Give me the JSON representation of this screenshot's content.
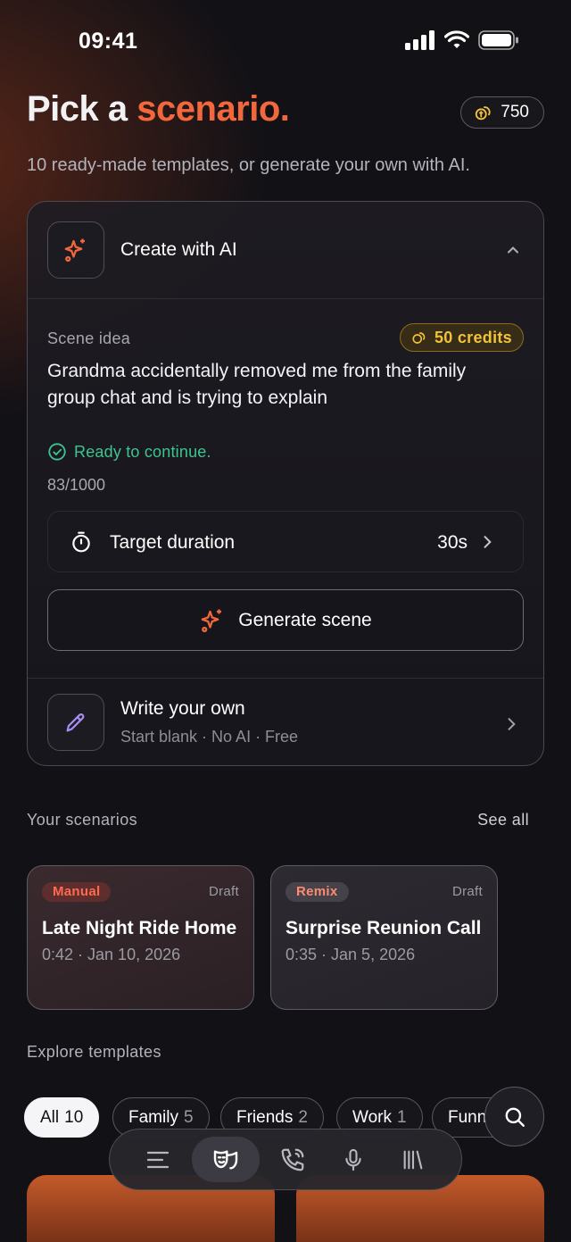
{
  "status": {
    "time": "09:41"
  },
  "header": {
    "title_main": "Pick a ",
    "title_accent": "scenario.",
    "credits": "750",
    "subtitle": "10 ready-made templates, or generate your own with AI."
  },
  "create_ai": {
    "title": "Create with AI",
    "scene_label": "Scene idea",
    "cost": "50 credits",
    "scene_text": "Grandma accidentally removed me from the family group chat and is trying to explain",
    "status": "Ready to continue.",
    "counter": "83/1000",
    "duration_label": "Target duration",
    "duration_value": "30s",
    "generate_label": "Generate scene"
  },
  "write_own": {
    "title": "Write your own",
    "subtitle": "Start blank · No AI · Free"
  },
  "your_scenarios": {
    "label": "Your scenarios",
    "see_all": "See all",
    "items": [
      {
        "badge": "Manual",
        "status": "Draft",
        "title": "Late Night Ride Home",
        "meta": "0:42 · Jan 10, 2026"
      },
      {
        "badge": "Remix",
        "status": "Draft",
        "title": "Surprise Reunion Call",
        "meta": "0:35 · Jan 5, 2026"
      }
    ]
  },
  "explore": {
    "label": "Explore templates",
    "chips": [
      {
        "label": "All",
        "count": "10"
      },
      {
        "label": "Family",
        "count": "5"
      },
      {
        "label": "Friends",
        "count": "2"
      },
      {
        "label": "Work",
        "count": "1"
      },
      {
        "label": "Funny",
        "count": ""
      }
    ]
  },
  "nav": {
    "items": [
      "menu-icon",
      "theater-masks-icon",
      "phone-icon",
      "microphone-icon",
      "library-icon"
    ],
    "active": "theater-masks-icon"
  },
  "colors": {
    "accent": "#f2683c",
    "credits_gold": "#f2c23a",
    "ready_green": "#3ec48f"
  }
}
